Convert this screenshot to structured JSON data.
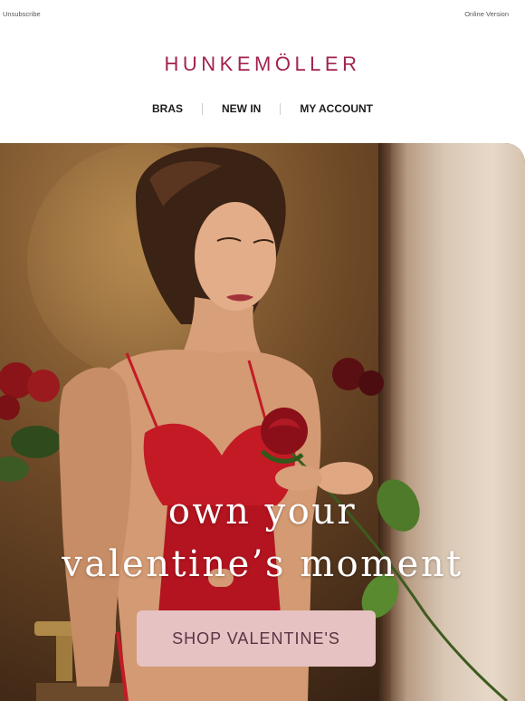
{
  "topbar": {
    "unsubscribe": "Unsubscribe",
    "online_version": "Online Version"
  },
  "brand": {
    "name": "HUNKEMÖLLER",
    "color": "#a3234f"
  },
  "nav": {
    "items": [
      {
        "label": "BRAS"
      },
      {
        "label": "NEW IN"
      },
      {
        "label": "MY ACCOUNT"
      }
    ]
  },
  "hero": {
    "headline_line1": "own your",
    "headline_line2": "valentine’s moment",
    "cta_label": "SHOP VALENTINE'S",
    "cta_color": "#e6c2c2"
  }
}
